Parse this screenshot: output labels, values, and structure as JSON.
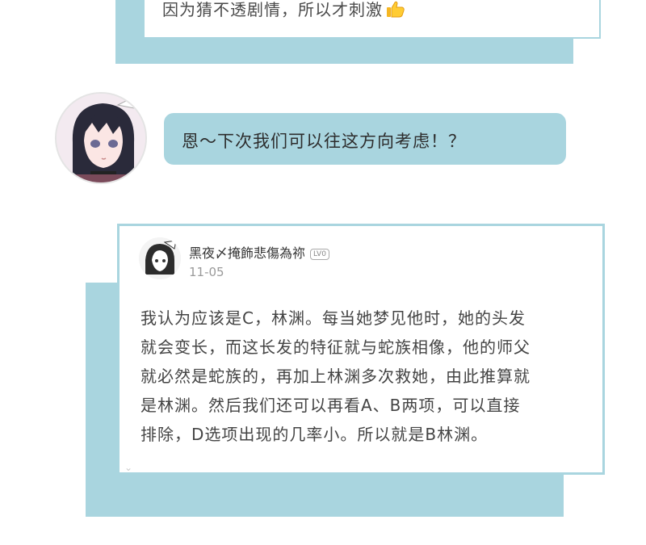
{
  "top_card": {
    "text": "因为猜不透剧情，所以才刺激",
    "emoji": "thumbs-up-icon"
  },
  "reply_bubble": {
    "text": "恩～下次我们可以往这方向考虑！？"
  },
  "comment": {
    "username": "黑夜〆掩飾悲傷為祢",
    "level_badge": "LV0",
    "date": "11-05",
    "lines": [
      "我认为应该是C，林渊。每当她梦见他时，她的头发",
      "就会变长，而这长发的特征就与蛇族相像，他的师父",
      "就必然是蛇族的，再加上林渊多次救她，由此推算就",
      "是林渊。然后我们还可以再看A、B两项，可以直接",
      "排除，D选项出现的几率小。所以就是B林渊。"
    ]
  },
  "colors": {
    "accent": "#a9d5df",
    "text": "#444444",
    "muted": "#9a9a9a"
  }
}
